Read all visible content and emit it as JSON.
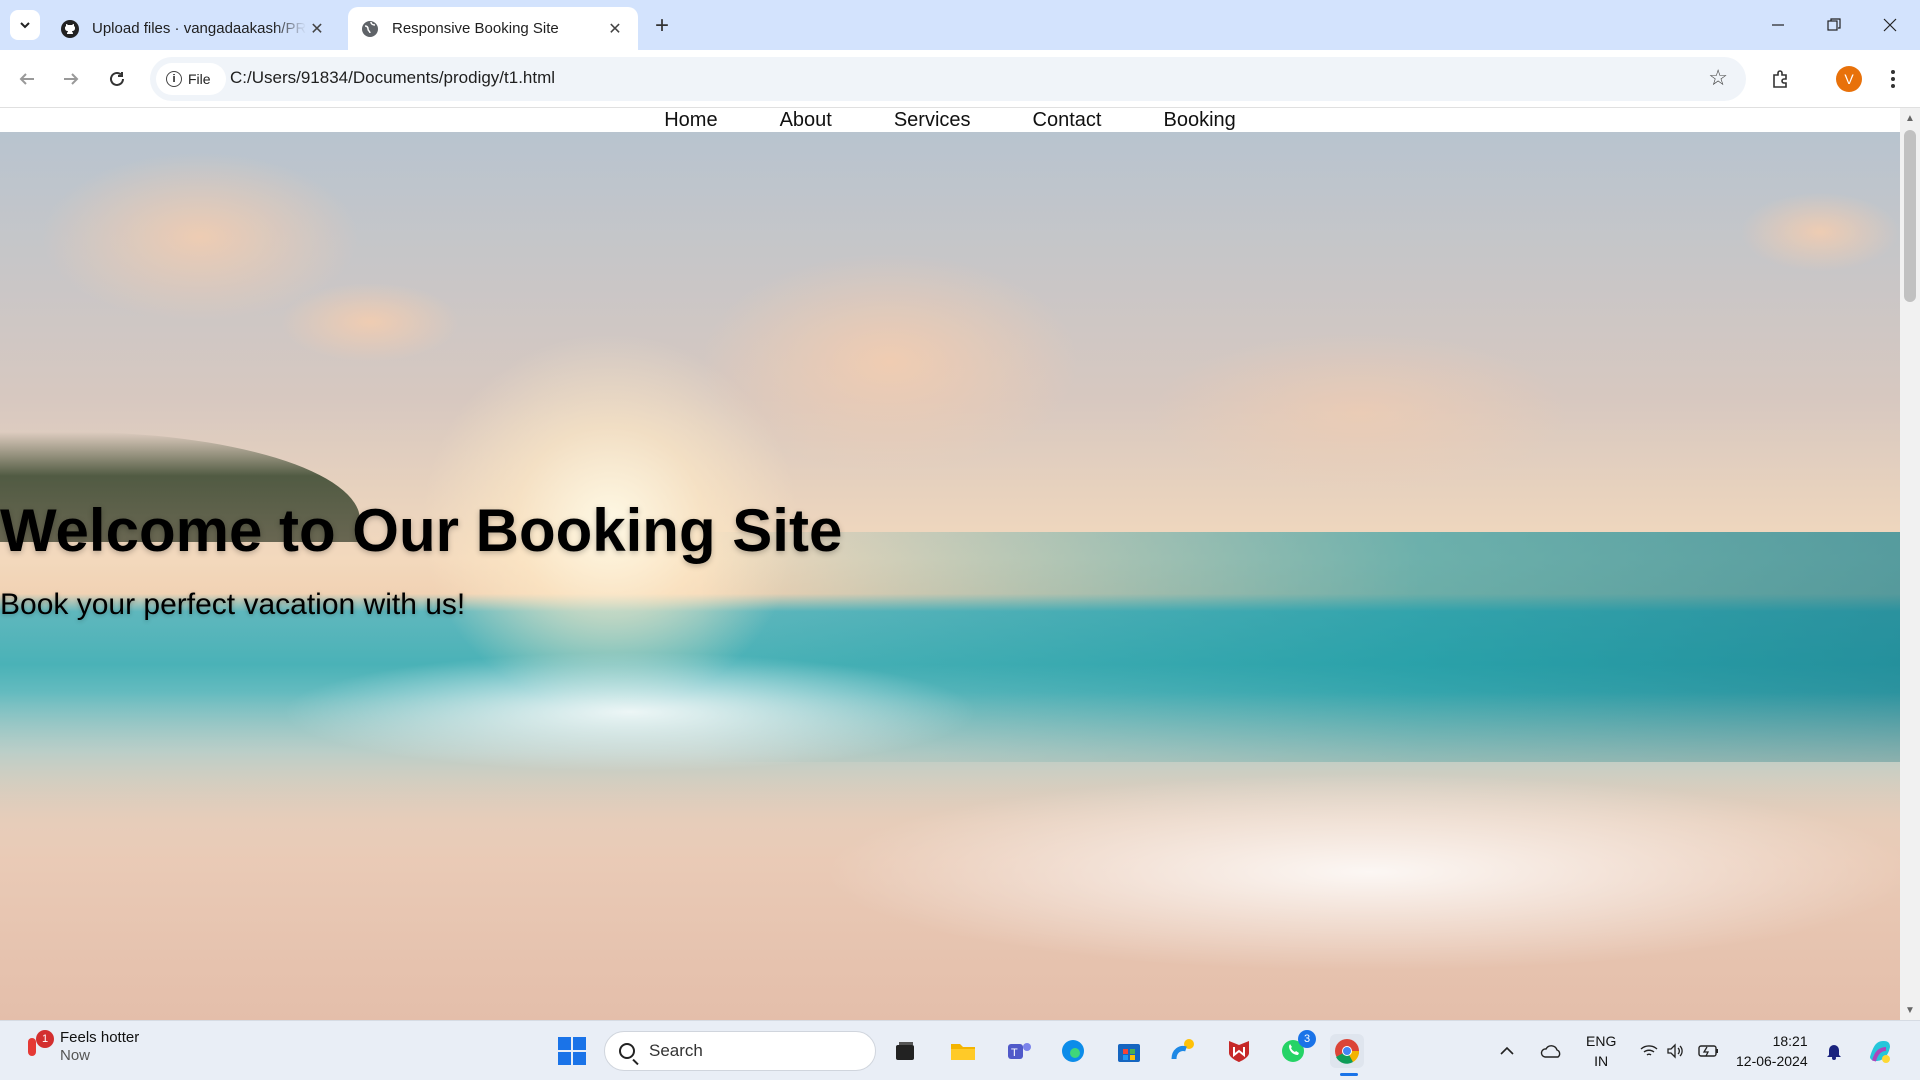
{
  "browser": {
    "tabs": [
      {
        "title": "Upload files · vangadaakash/PRODIGY",
        "favicon": "github-icon",
        "active": false
      },
      {
        "title": "Responsive Booking Site",
        "favicon": "globe-icon",
        "active": true
      }
    ],
    "chip_label": "File",
    "url": "C:/Users/91834/Documents/prodigy/t1.html",
    "profile_initial": "V"
  },
  "page": {
    "nav": [
      "Home",
      "About",
      "Services",
      "Contact",
      "Booking"
    ],
    "hero_title": "Welcome to Our Booking Site",
    "hero_subtitle": "Book your perfect vacation with us!"
  },
  "taskbar": {
    "weather_title": "Feels hotter",
    "weather_sub": "Now",
    "weather_badge": "1",
    "search_placeholder": "Search",
    "whatsapp_badge": "3",
    "lang_top": "ENG",
    "lang_bottom": "IN",
    "time": "18:21",
    "date": "12-06-2024"
  },
  "colors": {
    "tabstrip": "#d3e3fd",
    "accent": "#1a73e8",
    "avatar": "#e8710a"
  }
}
